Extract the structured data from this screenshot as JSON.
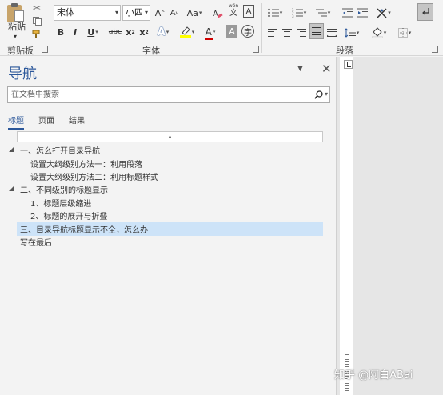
{
  "ribbon": {
    "clipboard": {
      "label": "剪贴板",
      "paste_label": "粘贴"
    },
    "font": {
      "label": "字体",
      "font_name": "宋体",
      "font_size": "小四",
      "grow": "A",
      "shrink": "A",
      "case": "Aa",
      "phonetic": "wén",
      "bold": "B",
      "italic": "I",
      "underline": "U",
      "strike": "abc",
      "subscript": "x",
      "superscript": "x",
      "sub_mark": "2",
      "sup_mark": "2"
    },
    "paragraph": {
      "label": "段落"
    }
  },
  "nav": {
    "title": "导航",
    "search_placeholder": "在文档中搜索",
    "tabs": [
      "标题",
      "页面",
      "结果"
    ],
    "headings": [
      {
        "text": "一、怎么打开目录导航"
      },
      {
        "text": "设置大纲级别方法一：利用段落"
      },
      {
        "text": "设置大纲级别方法二：利用标题样式"
      },
      {
        "text": "二、不同级别的标题显示"
      },
      {
        "text": "1、标题层级缩进"
      },
      {
        "text": "2、标题的展开与折叠"
      },
      {
        "text": "三、目录导航标题显示不全，怎么办"
      },
      {
        "text": "写在最后"
      }
    ]
  },
  "watermark": "知乎 @阿白ABai",
  "colors": {
    "accent": "#2b579a",
    "selection": "#cde3f8",
    "font_color_red": "#d00000",
    "highlight_yellow": "#ffff00"
  }
}
